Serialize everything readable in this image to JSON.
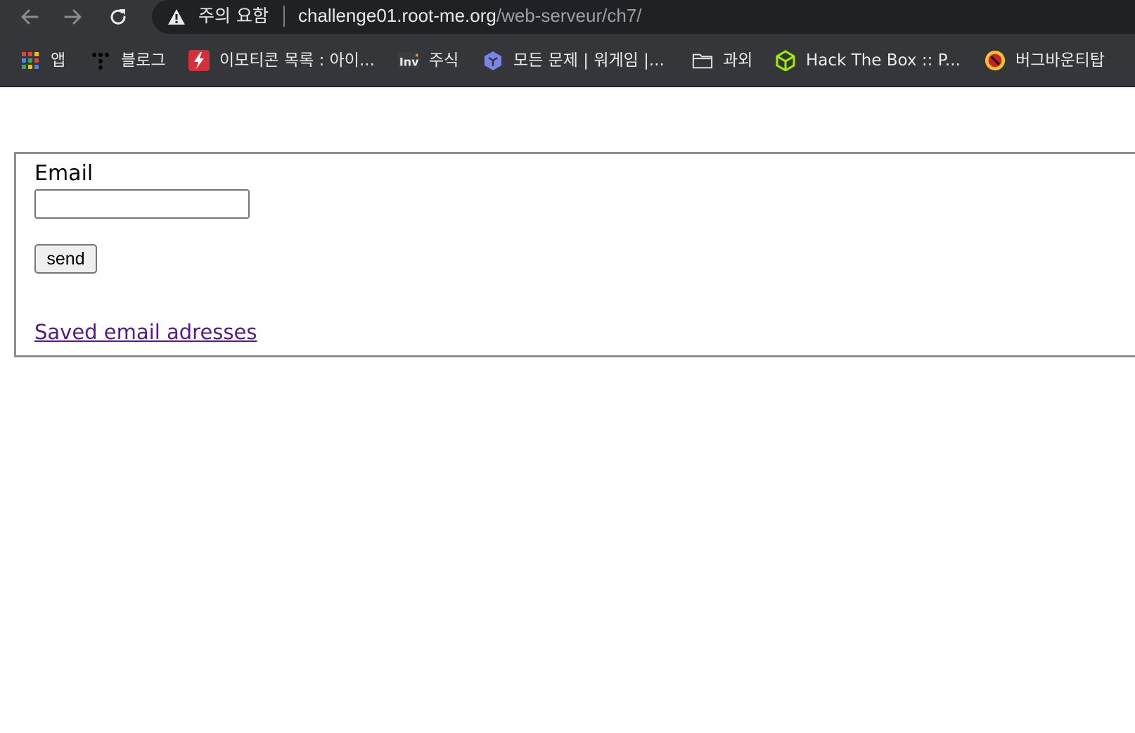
{
  "browser": {
    "security_label": "주의 요함",
    "url_host": "challenge01.root-me.org",
    "url_path": "/web-serveur/ch7/",
    "icons": {
      "back": "arrow-left-icon",
      "forward": "arrow-right-icon",
      "reload": "reload-icon",
      "security": "warning-triangle-icon"
    }
  },
  "bookmarks": [
    {
      "label": "앱",
      "icon": "apps-grid-icon"
    },
    {
      "label": "블로그",
      "icon": "tistory-icon"
    },
    {
      "label": "이모티콘 목록 : 아이...",
      "icon": "lightning-icon"
    },
    {
      "label": "주식",
      "icon": "inv-icon"
    },
    {
      "label": "모든 문제 | 워게임 |...",
      "icon": "hexagon-icon"
    },
    {
      "label": "과외",
      "icon": "folder-icon"
    },
    {
      "label": "Hack The Box :: P...",
      "icon": "cube-icon"
    },
    {
      "label": "버그바운티탑",
      "icon": "bug-badge-icon"
    }
  ],
  "page": {
    "email_label": "Email",
    "email_value": "",
    "send_label": "send",
    "saved_link": "Saved email adresses",
    "colors": {
      "link_visited": "#551a8b",
      "frame_border": "#8e8e8e",
      "chrome_background": "#35363a",
      "omnibox_background": "#202124"
    }
  }
}
